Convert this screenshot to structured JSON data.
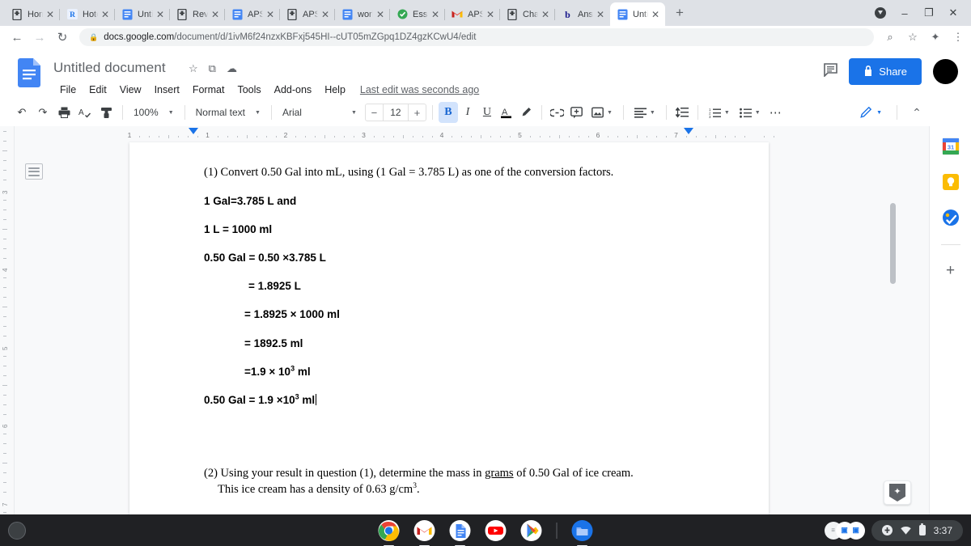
{
  "browser": {
    "tabs": [
      {
        "label": "Home",
        "favicon": "book-icon",
        "fav_color": "#3c4043"
      },
      {
        "label": "Hotel",
        "favicon": "r-letter-icon",
        "fav_color": "#1a73e8"
      },
      {
        "label": "Untitl",
        "favicon": "docs-icon",
        "fav_color": "#4285f4"
      },
      {
        "label": "Review",
        "favicon": "book-icon",
        "fav_color": "#3c4043"
      },
      {
        "label": "APS_",
        "favicon": "docs-icon",
        "fav_color": "#4285f4"
      },
      {
        "label": "APS (",
        "favicon": "book-icon",
        "fav_color": "#3c4043"
      },
      {
        "label": "works",
        "favicon": "docs-icon",
        "fav_color": "#4285f4"
      },
      {
        "label": "Essay",
        "favicon": "green-check-icon",
        "fav_color": "#34a853"
      },
      {
        "label": "APS A",
        "favicon": "gmail-icon",
        "fav_color": "#ea4335"
      },
      {
        "label": "Chapt",
        "favicon": "book-icon",
        "fav_color": "#3c4043"
      },
      {
        "label": "Answ",
        "favicon": "b-letter-icon",
        "fav_color": "#1a1a8c"
      },
      {
        "label": "Untitl",
        "favicon": "docs-icon",
        "fav_color": "#4285f4",
        "active": true
      }
    ],
    "new_tab_label": "+",
    "close_glyph": "✕",
    "window_controls": {
      "minimize": "–",
      "maximize": "❐",
      "close": "✕"
    },
    "nav": {
      "back": "←",
      "forward": "→",
      "reload": "↻"
    },
    "url_host": "docs.google.com",
    "url_path": "/document/d/1ivM6f24nzxKBFxj545HI--cUT05mZGpq1DZ4gzKCwU4/edit",
    "lock_glyph": "🔒",
    "omni_icons": {
      "zoom": "⌕",
      "star": "☆",
      "ext": "✦",
      "menu": "⋮"
    }
  },
  "docs": {
    "title": "Untitled document",
    "title_icons": [
      {
        "name": "star-icon",
        "glyph": "☆"
      },
      {
        "name": "move-to-folder-icon",
        "glyph": "⧉"
      },
      {
        "name": "cloud-saved-icon",
        "glyph": "☁"
      }
    ],
    "menus": [
      "File",
      "Edit",
      "View",
      "Insert",
      "Format",
      "Tools",
      "Add-ons",
      "Help"
    ],
    "last_edit": "Last edit was seconds ago",
    "share_label": "Share",
    "share_color": "#1a73e8",
    "comment_icon": "comment-icon",
    "avatar": "user-avatar"
  },
  "toolbar": {
    "undo": "↶",
    "redo": "↷",
    "print": "⎙",
    "spellcheck": "A✓",
    "paint_format": "paint-format-icon",
    "zoom_value": "100%",
    "style_value": "Normal text",
    "font_value": "Arial",
    "font_size": "12",
    "font_minus": "−",
    "font_plus": "+",
    "bold": "B",
    "italic": "I",
    "underline": "U",
    "text_color": "A",
    "highlight": "highlight-pen-icon",
    "link": "🔗",
    "comment": "insert-comment-icon",
    "image": "insert-image-icon",
    "align": "align-icon",
    "line_spacing": "line-spacing-icon",
    "numbered_list": "numbered-list-icon",
    "bulleted_list": "bulleted-list-icon",
    "more": "⋯",
    "editing_mode": "editing-pencil-icon",
    "collapse": "⌃"
  },
  "ruler": {
    "horizontal_numbers": [
      "1",
      "1",
      "2",
      "3",
      "4",
      "5",
      "6",
      "7"
    ],
    "vertical_numbers": [
      "3",
      "4",
      "5",
      "6",
      "7"
    ]
  },
  "document": {
    "question_1": {
      "number": "(1)",
      "text": "Convert 0.50 Gal into mL, using (1 Gal = 3.785 L) as one of the conversion factors."
    },
    "work_lines": [
      {
        "text": "1 Gal=3.785 L and",
        "indent": 0
      },
      {
        "text": "1 L = 1000 ml",
        "indent": 0
      },
      {
        "text": "0.50 Gal = 0.50 ×3.785 L",
        "indent": 0
      },
      {
        "text": "= 1.8925 L",
        "indent": 55
      },
      {
        "text": "= 1.8925 × 1000 ml",
        "indent": 50
      },
      {
        "text": "= 1892.5 ml",
        "indent": 50
      },
      {
        "text": "=1.9 × 10",
        "sup": "3",
        "tail": " ml",
        "indent": 50
      },
      {
        "text": "0.50 Gal = 1.9 ×10",
        "sup": "3",
        "tail": " ml",
        "indent": 0,
        "cursor": true
      }
    ],
    "question_2": {
      "number": "(2)",
      "line1_a": "Using your result in question (1), determine the mass in ",
      "line1_underlined": "grams",
      "line1_b": " of 0.50 Gal of ice cream.",
      "line2_a": "This ice cream has a density of 0.63 g/cm",
      "line2_sup": "3",
      "line2_b": "."
    }
  },
  "side_panel": {
    "items": [
      {
        "name": "google-calendar-icon",
        "label": "Calendar"
      },
      {
        "name": "google-keep-icon",
        "label": "Keep"
      },
      {
        "name": "google-tasks-icon",
        "label": "Tasks"
      }
    ],
    "add_label": "+",
    "explore_icon": "explore-spark-icon",
    "chevron": "›"
  },
  "shelf": {
    "launcher": "launcher-button",
    "apps": [
      {
        "name": "chrome-icon",
        "running": true
      },
      {
        "name": "gmail-icon",
        "running": true
      },
      {
        "name": "google-docs-icon",
        "running": true
      },
      {
        "name": "youtube-icon",
        "running": false
      },
      {
        "name": "google-play-icon",
        "running": false
      },
      {
        "name": "files-icon",
        "running": true
      }
    ],
    "tray": {
      "upload_glyph": "⬆",
      "wifi": "wifi-icon",
      "battery": "battery-icon",
      "time": "3:37"
    }
  }
}
